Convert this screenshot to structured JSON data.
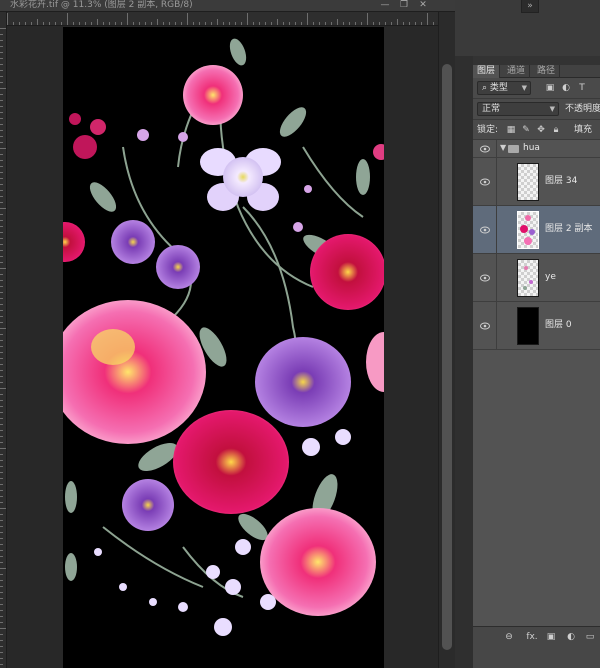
{
  "document": {
    "tab_title": "水彩花卉.tif @ 11.3% (图层 2 副本, RGB/8)",
    "window_buttons": [
      "—",
      "❐",
      "✕"
    ]
  },
  "dock": {
    "top_icon": "»"
  },
  "layers_panel": {
    "tabs": [
      {
        "label": "图层",
        "active": true
      },
      {
        "label": "通道",
        "active": false
      },
      {
        "label": "路径",
        "active": false
      }
    ],
    "filter_kind": "类型",
    "filter_icons": [
      "image-filter-icon",
      "adjustment-filter-icon",
      "text-filter-icon"
    ],
    "blend_mode": "正常",
    "opacity_label": "不透明度",
    "lock_label": "锁定:",
    "lock_icons": [
      "lock-transparent-icon",
      "lock-paint-icon",
      "lock-position-icon",
      "lock-all-icon"
    ],
    "fill_label": "填充",
    "group": {
      "name": "hua",
      "expanded": true
    },
    "layers": [
      {
        "name": "图层 34",
        "thumb": "checker",
        "selected": false
      },
      {
        "name": "图层 2 副本",
        "thumb": "flowers",
        "selected": true
      },
      {
        "name": "ye",
        "thumb": "leaves",
        "selected": false
      },
      {
        "name": "图层 0",
        "thumb": "black",
        "selected": false
      }
    ],
    "bottom_icons": [
      "link-layers-icon",
      "fx-icon",
      "add-mask-icon",
      "adjustment-layer-icon",
      "new-group-icon"
    ],
    "bottom_labels": {
      "link": "⊖",
      "fx": "fx.",
      "mask": "▣",
      "adjust": "◐",
      "folder": "▭"
    }
  },
  "colors": {
    "app_bg": "#535353",
    "canvas_bg": "#282828",
    "artboard": "#000000",
    "selected_layer": "#5f6b7b",
    "magenta": "#e0106a",
    "pink": "#f46fb4",
    "purple": "#9a5fd0",
    "leaf": "#8fa596"
  }
}
